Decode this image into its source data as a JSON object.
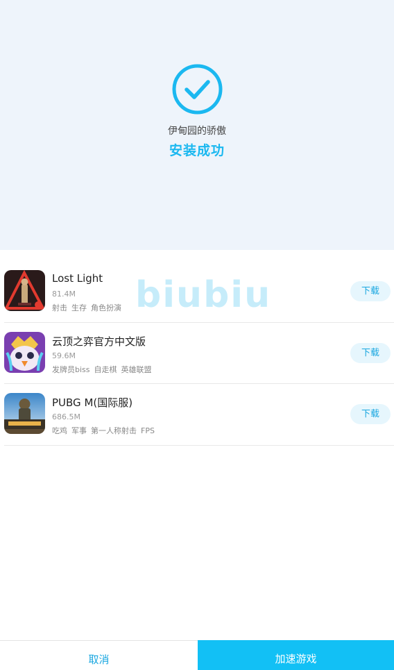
{
  "install": {
    "app_name": "伊甸园的骄傲",
    "status": "安装成功"
  },
  "watermark": "biubiu",
  "apps": [
    {
      "title": "Lost Light",
      "size": "81.4M",
      "tags": [
        "射击",
        "生存",
        "角色扮演"
      ],
      "download": "下载"
    },
    {
      "title": "云顶之弈官方中文版",
      "size": "59.6M",
      "tags": [
        "发牌员biss",
        "自走棋",
        "英雄联盟"
      ],
      "download": "下载"
    },
    {
      "title": "PUBG M(国际服)",
      "size": "686.5M",
      "tags": [
        "吃鸡",
        "军事",
        "第一人称射击",
        "FPS"
      ],
      "download": "下载"
    }
  ],
  "footer": {
    "cancel": "取消",
    "accelerate": "加速游戏"
  },
  "colors": {
    "accent": "#1bb8f0",
    "primary_button": "#12c0f5",
    "hero_bg": "#eef4fb"
  },
  "icons": {
    "success": "check-circle-icon"
  }
}
